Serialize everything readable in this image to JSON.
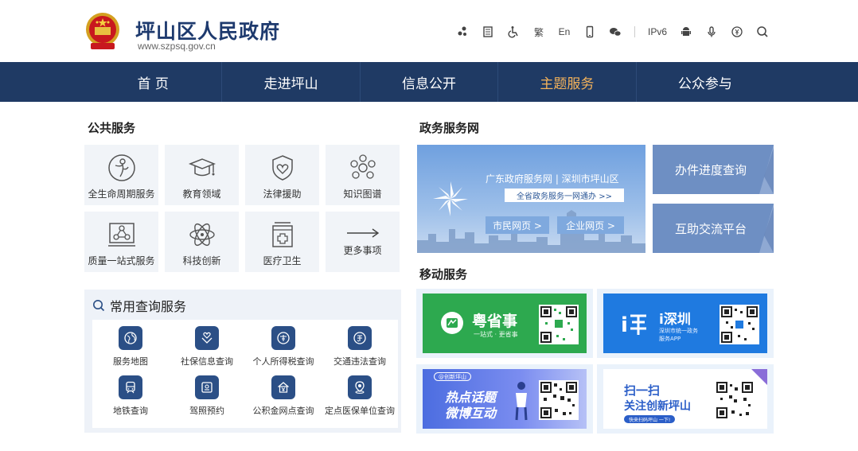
{
  "header": {
    "title": "坪山区人民政府",
    "url": "www.szpsq.gov.cn",
    "tools": {
      "traditional": "繁",
      "english": "En",
      "ipv6": "IPv6"
    }
  },
  "nav": {
    "items": [
      {
        "label": "首 页"
      },
      {
        "label": "走进坪山"
      },
      {
        "label": "信息公开"
      },
      {
        "label": "主题服务"
      },
      {
        "label": "公众参与"
      }
    ],
    "active_color": "#f5b35a",
    "bar_color": "#1f3a64"
  },
  "public_service": {
    "title": "公共服务",
    "items": [
      {
        "label": "全生命周期服务",
        "icon": "person-circle-icon"
      },
      {
        "label": "教育领域",
        "icon": "graduation-cap-icon"
      },
      {
        "label": "法律援助",
        "icon": "shield-heart-icon"
      },
      {
        "label": "知识图谱",
        "icon": "network-icon"
      },
      {
        "label": "质量一站式服务",
        "icon": "quality-network-icon"
      },
      {
        "label": "科技创新",
        "icon": "atom-icon"
      },
      {
        "label": "医疗卫生",
        "icon": "medical-cross-icon"
      },
      {
        "label": "更多事项",
        "icon": "arrow-right-icon"
      }
    ]
  },
  "query": {
    "title": "常用查询服务",
    "items": [
      {
        "label": "服务地图",
        "icon": "globe-icon"
      },
      {
        "label": "社保信息查询",
        "icon": "heart-hands-icon"
      },
      {
        "label": "个人所得税查询",
        "icon": "tax-icon"
      },
      {
        "label": "交通违法查询",
        "icon": "traffic-icon"
      },
      {
        "label": "地铁查询",
        "icon": "subway-icon"
      },
      {
        "label": "驾照预约",
        "icon": "license-icon"
      },
      {
        "label": "公积金网点查询",
        "icon": "house-fund-icon"
      },
      {
        "label": "定点医保单位查询",
        "icon": "location-icon"
      }
    ]
  },
  "gov_service": {
    "title": "政务服务网",
    "banner_title": "广东政府服务网 | 深圳市坪山区",
    "banner_sub": "全省政务服务一网通办  >>",
    "citizen_btn": "市民网页 >",
    "enterprise_btn": "企业网页 >",
    "progress_btn": "办件进度查询",
    "exchange_btn": "互助交流平台"
  },
  "mobile": {
    "title": "移动服务",
    "yss": {
      "name": "粤省事",
      "tagline": "一站式 · 更省事"
    },
    "isz": {
      "name": "i深圳",
      "desc1": "深圳市统一政务",
      "desc2": "服务APP"
    },
    "weibo": {
      "tag": "@创新坪山",
      "line1": "热点话题",
      "line2": "微博互动"
    },
    "wechat": {
      "line1": "扫一扫",
      "line2": "关注创新坪山",
      "tag": "快来扫码坪山 一下!"
    }
  }
}
